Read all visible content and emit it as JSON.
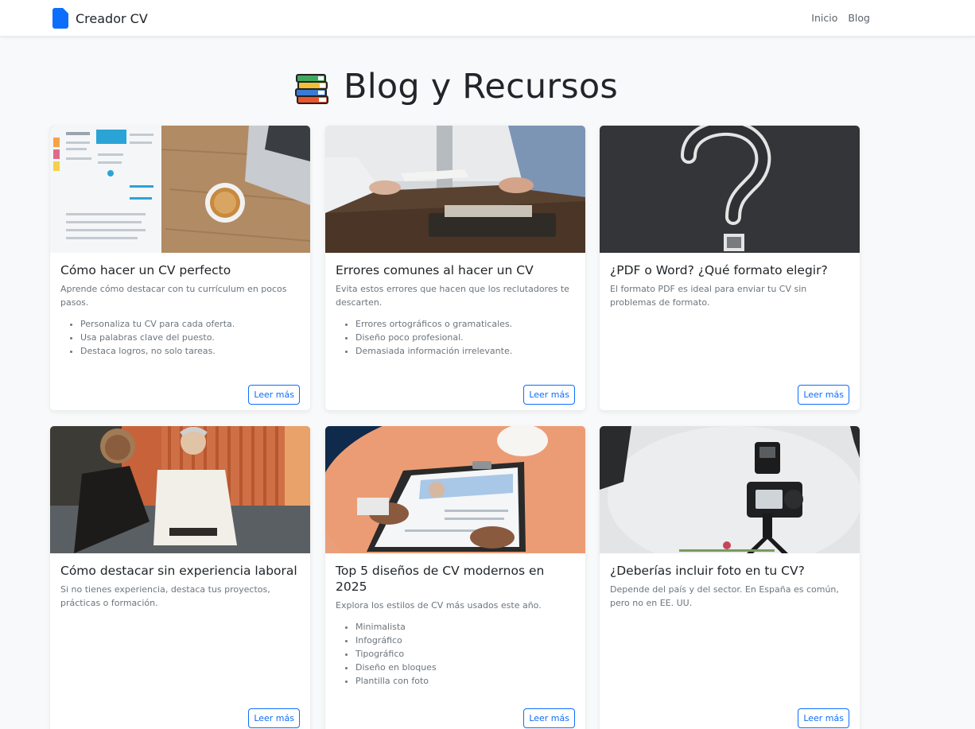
{
  "navbar": {
    "brand": "Creador CV",
    "links": [
      "Inicio",
      "Blog"
    ]
  },
  "page": {
    "title": "Blog y Recursos"
  },
  "colors": {
    "accent": "#0d6efd",
    "background": "#f8f9fa",
    "muted_text": "#6c757d"
  },
  "cards": [
    {
      "image": "cv-documents-coffee-laptop-photo",
      "title": "Cómo hacer un CV perfecto",
      "text": "Aprende cómo destacar con tu currículum en pocos pasos.",
      "list": [
        "Personaliza tu CV para cada oferta.",
        "Usa palabras clave del puesto.",
        "Destaca logros, no solo tareas."
      ],
      "button": "Leer más"
    },
    {
      "image": "interview-handing-document-photo",
      "title": "Errores comunes al hacer un CV",
      "text": "Evita estos errores que hacen que los reclutadores te descarten.",
      "list": [
        "Errores ortográficos o gramaticales.",
        "Diseño poco profesional.",
        "Demasiada información irrelevante."
      ],
      "button": "Leer más"
    },
    {
      "image": "chalk-question-mark-photo",
      "title": "¿PDF o Word? ¿Qué formato elegir?",
      "text": "El formato PDF es ideal para enviar tu CV sin problemas de formato.",
      "list": [],
      "button": "Leer más"
    },
    {
      "image": "two-women-conversation-photo",
      "title": "Cómo destacar sin experiencia laboral",
      "text": "Si no tienes experiencia, destaca tus proyectos, prácticas o formación.",
      "list": [],
      "button": "Leer más"
    },
    {
      "image": "clipboard-resume-peach-table-photo",
      "title": "Top 5 diseños de CV modernos en 2025",
      "text": "Explora los estilos de CV más usados este año.",
      "list": [
        "Minimalista",
        "Infográfico",
        "Tipográfico",
        "Diseño en bloques",
        "Plantilla con foto"
      ],
      "button": "Leer más"
    },
    {
      "image": "camera-on-tripod-studio-photo",
      "title": "¿Deberías incluir foto en tu CV?",
      "text": "Depende del país y del sector. En España es común, pero no en EE. UU.",
      "list": [],
      "button": "Leer más"
    }
  ]
}
